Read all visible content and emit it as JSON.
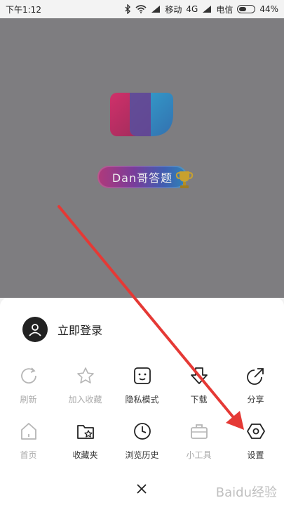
{
  "status": {
    "time": "下午1:12",
    "carrier1": "移动",
    "net": "4G",
    "carrier2": "电信",
    "battery": "44%"
  },
  "brand": {
    "badge_text": "Dan哥答题"
  },
  "login": {
    "label": "立即登录"
  },
  "menu": {
    "row1": [
      {
        "label": "刷新",
        "icon": "refresh-icon",
        "disabled": true
      },
      {
        "label": "加入收藏",
        "icon": "star-icon",
        "disabled": true
      },
      {
        "label": "隐私模式",
        "icon": "privacy-face-icon",
        "disabled": false
      },
      {
        "label": "下载",
        "icon": "download-icon",
        "disabled": false
      },
      {
        "label": "分享",
        "icon": "share-icon",
        "disabled": false
      }
    ],
    "row2": [
      {
        "label": "首页",
        "icon": "home-icon",
        "disabled": true
      },
      {
        "label": "收藏夹",
        "icon": "bookmark-folder-icon",
        "disabled": false
      },
      {
        "label": "浏览历史",
        "icon": "history-clock-icon",
        "disabled": false
      },
      {
        "label": "小工具",
        "icon": "toolbox-icon",
        "disabled": true
      },
      {
        "label": "设置",
        "icon": "settings-icon",
        "disabled": false
      }
    ]
  },
  "colors": {
    "dim": "#7e7d80",
    "arrow": "#e53935",
    "text": "#333333",
    "disabled": "#aaaaaa"
  },
  "watermark": "Baidu经验"
}
